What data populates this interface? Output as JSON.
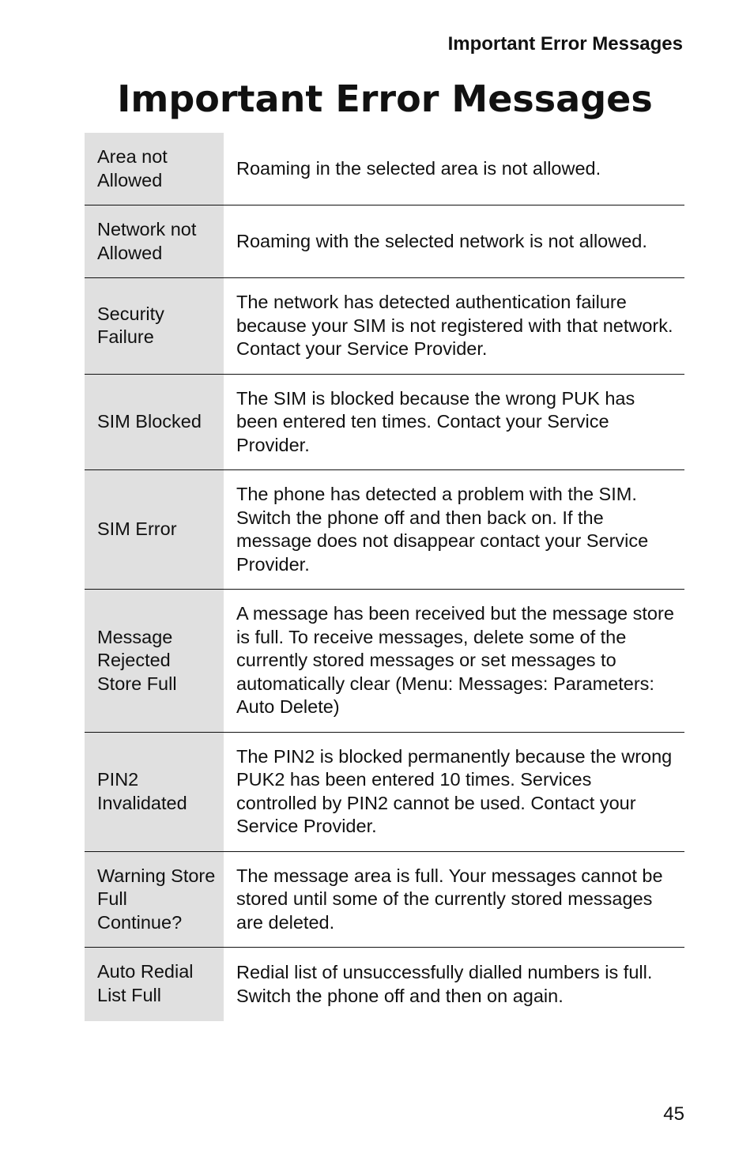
{
  "running_header": "Important Error Messages",
  "title": "Important Error Messages",
  "rows": [
    {
      "term": "Area not Allowed",
      "description": "Roaming in the selected area is not allowed."
    },
    {
      "term": "Network not Allowed",
      "description": "Roaming with the selected network is not allowed."
    },
    {
      "term": "Security Failure",
      "description": "The network has detected authentication failure because your SIM is not registered with that network. Contact your Service Provider."
    },
    {
      "term": "SIM Blocked",
      "description": "The SIM is blocked because the wrong PUK has been entered ten times. Contact your Service Provider."
    },
    {
      "term": "SIM Error",
      "description": "The phone has detected a problem with the SIM. Switch the phone off and then back on. If the message does not disappear contact your Service Provider."
    },
    {
      "term": "Message Rejected Store Full",
      "description": "A message has been received but the message store is full. To receive messages, delete some of the currently stored messages or set messages to automatically clear (Menu: Messages: Parameters: Auto Delete)"
    },
    {
      "term": "PIN2 Invalidated",
      "description": "The PIN2 is blocked permanently because the wrong PUK2 has been entered 10 times. Services controlled by PIN2 cannot be used. Contact your Service Provider."
    },
    {
      "term": "Warning Store Full Continue?",
      "description": "The message area is full. Your messages cannot be stored until some of the currently stored messages are deleted."
    },
    {
      "term": "Auto Redial List Full",
      "description": "Redial list of unsuccessfully dialled numbers is full. Switch the phone off and then on again."
    }
  ],
  "page_number": "45"
}
